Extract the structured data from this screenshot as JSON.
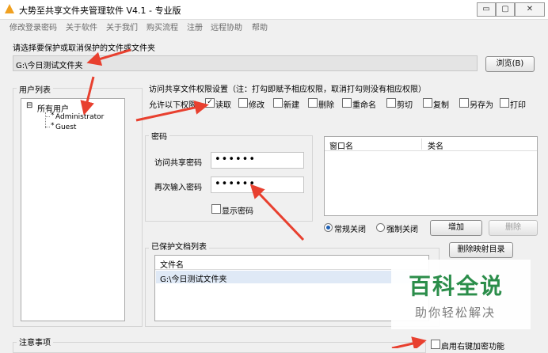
{
  "window": {
    "title": "大势至共享文件夹管理软件 V4.1 - 专业版",
    "controls": {
      "minimize": "▭",
      "maximize": "▢",
      "close": "✕"
    }
  },
  "menu": [
    "修改登录密码",
    "关于软件",
    "关于我们",
    "购买流程",
    "注册",
    "远程协助",
    "帮助"
  ],
  "folder_select": {
    "label": "请选择要保护或取消保护的文件或文件夹",
    "path": "G:\\今日测试文件夹",
    "browse_button": "浏览(B)"
  },
  "user_list": {
    "title": "用户列表",
    "toggle": "⊟",
    "root": "所有用户",
    "users": [
      "Administrator",
      "Guest"
    ]
  },
  "permissions": {
    "title": "访问共享文件权限设置（注：打勾即赋予相应权限，取消打勾则没有相应权限）",
    "allow_label": "允许以下权限",
    "items": [
      {
        "label": "读取",
        "checked": true
      },
      {
        "label": "修改",
        "checked": false
      },
      {
        "label": "新建",
        "checked": false
      },
      {
        "label": "删除",
        "checked": false
      },
      {
        "label": "重命名",
        "checked": false
      },
      {
        "label": "剪切",
        "checked": false
      },
      {
        "label": "复制",
        "checked": false
      },
      {
        "label": "另存为",
        "checked": false
      },
      {
        "label": "打印",
        "checked": false
      }
    ]
  },
  "password": {
    "title": "密码",
    "access_label": "访问共享密码",
    "access_value": "••••••",
    "confirm_label": "再次输入密码",
    "confirm_value": "••••••",
    "show_label": "显示密码",
    "show_checked": false
  },
  "window_table": {
    "columns": [
      "窗口名",
      "类名"
    ]
  },
  "close_mode": {
    "normal_label": "常规关闭",
    "normal_selected": true,
    "force_label": "强制关闭",
    "force_selected": false,
    "add_button": "增加",
    "delete_button": "删除"
  },
  "protected_docs": {
    "title": "已保护文档列表",
    "column": "文件名",
    "rows": [
      "G:\\今日测试文件夹"
    ],
    "delete_mapping_button": "删除映射目录"
  },
  "notes": {
    "title": "注意事项"
  },
  "right_click_encrypt": {
    "label": "启用右键加密功能",
    "checked": false
  },
  "watermark": {
    "title": "百科全说",
    "subtitle": "助你轻松解决"
  },
  "colors": {
    "arrow": "#e8402f",
    "watermark_green": "#2b8d4a",
    "selection": "#dfe9f6"
  }
}
